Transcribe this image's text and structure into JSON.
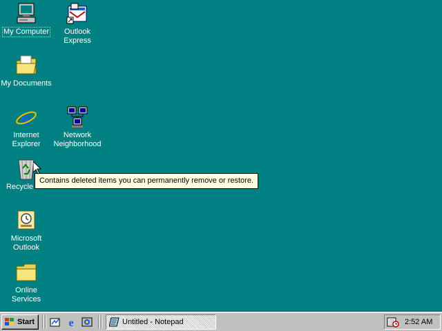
{
  "desktop": {
    "background_color": "#008080",
    "icons": [
      {
        "id": "my-computer",
        "label": "My Computer",
        "icon": "computer-icon"
      },
      {
        "id": "outlook-express",
        "label": "Outlook\nExpress",
        "icon": "outlook-express-icon"
      },
      {
        "id": "my-documents",
        "label": "My Documents",
        "icon": "folder-documents-icon"
      },
      {
        "id": "internet-explorer",
        "label": "Internet\nExplorer",
        "icon": "internet-explorer-icon"
      },
      {
        "id": "network-neighborhood",
        "label": "Network\nNeighborhood",
        "icon": "network-icon"
      },
      {
        "id": "recycle-bin",
        "label": "Recycle Bin",
        "icon": "recycle-bin-icon"
      },
      {
        "id": "microsoft-outlook",
        "label": "Microsoft\nOutlook",
        "icon": "microsoft-outlook-icon"
      },
      {
        "id": "online-services",
        "label": "Online\nServices",
        "icon": "folder-icon"
      }
    ]
  },
  "tooltip": {
    "text": "Contains deleted items you can permanently remove or restore."
  },
  "taskbar": {
    "start_label": "Start",
    "quick_launch": [
      {
        "name": "show-desktop-icon"
      },
      {
        "name": "internet-explorer-icon"
      },
      {
        "name": "channels-icon"
      }
    ],
    "tasks": [
      {
        "label": "Untitled - Notepad",
        "icon": "notepad-icon"
      }
    ],
    "tray": {
      "icons": [
        "scheduler-icon"
      ],
      "clock": "2:52 AM"
    }
  }
}
